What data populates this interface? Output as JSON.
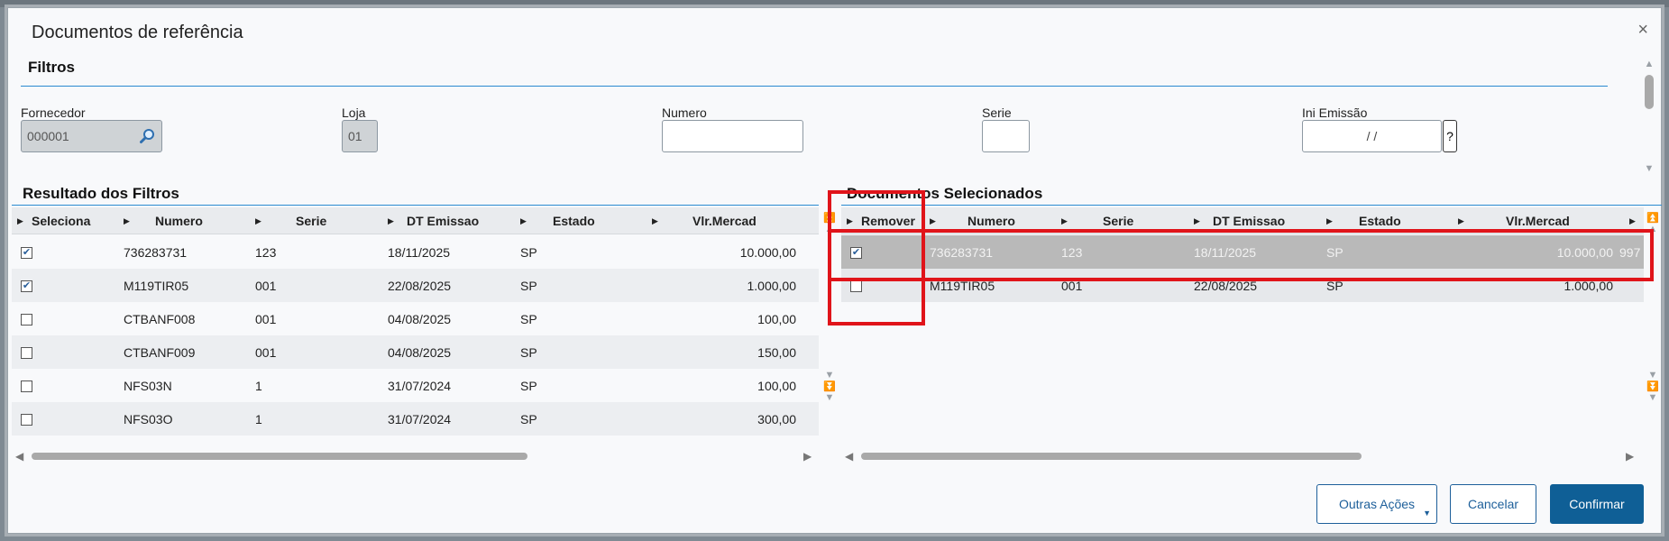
{
  "dialog": {
    "title": "Documentos de referência",
    "close": "×"
  },
  "filters": {
    "title": "Filtros",
    "fornecedor": {
      "label": "Fornecedor",
      "value": "000001"
    },
    "loja": {
      "label": "Loja",
      "value": "01"
    },
    "numero": {
      "label": "Numero",
      "value": ""
    },
    "serie": {
      "label": "Serie",
      "value": ""
    },
    "ini_emissao": {
      "label": "Ini Emissão",
      "value": "/ /",
      "help": "?"
    }
  },
  "results": {
    "title": "Resultado dos Filtros",
    "columns": [
      "Seleciona",
      "Numero",
      "Serie",
      "DT Emissao",
      "Estado",
      "Vlr.Mercad"
    ],
    "rows": [
      {
        "checked": true,
        "numero": "736283731",
        "serie": "123",
        "dt": "18/11/2025",
        "estado": "SP",
        "valor": "10.000,00"
      },
      {
        "checked": true,
        "numero": "M119TIR05",
        "serie": "001",
        "dt": "22/08/2025",
        "estado": "SP",
        "valor": "1.000,00"
      },
      {
        "checked": false,
        "numero": "CTBANF008",
        "serie": "001",
        "dt": "04/08/2025",
        "estado": "SP",
        "valor": "100,00"
      },
      {
        "checked": false,
        "numero": "CTBANF009",
        "serie": "001",
        "dt": "04/08/2025",
        "estado": "SP",
        "valor": "150,00"
      },
      {
        "checked": false,
        "numero": "NFS03N",
        "serie": "1",
        "dt": "31/07/2024",
        "estado": "SP",
        "valor": "100,00"
      },
      {
        "checked": false,
        "numero": "NFS03O",
        "serie": "1",
        "dt": "31/07/2024",
        "estado": "SP",
        "valor": "300,00"
      }
    ]
  },
  "selected": {
    "title": "Documentos Selecionados",
    "columns": [
      "Remover",
      "Numero",
      "Serie",
      "DT Emissao",
      "Estado",
      "Vlr.Mercad"
    ],
    "rows": [
      {
        "checked": true,
        "numero": "736283731",
        "serie": "123",
        "dt": "18/11/2025",
        "estado": "SP",
        "valor": "10.000,00",
        "extra": "997"
      },
      {
        "checked": false,
        "numero": "M119TIR05",
        "serie": "001",
        "dt": "22/08/2025",
        "estado": "SP",
        "valor": "1.000,00",
        "extra": ""
      }
    ]
  },
  "buttons": {
    "outras": "Outras Ações",
    "cancelar": "Cancelar",
    "confirmar": "Confirmar"
  },
  "colors": {
    "primary": "#0f5f96",
    "accent_line": "#2a8ad0",
    "annotation": "#e0141a",
    "selected_row": "#b9b9b9"
  },
  "icons": {
    "fornecedor_search": "search-icon",
    "close": "close-icon"
  }
}
